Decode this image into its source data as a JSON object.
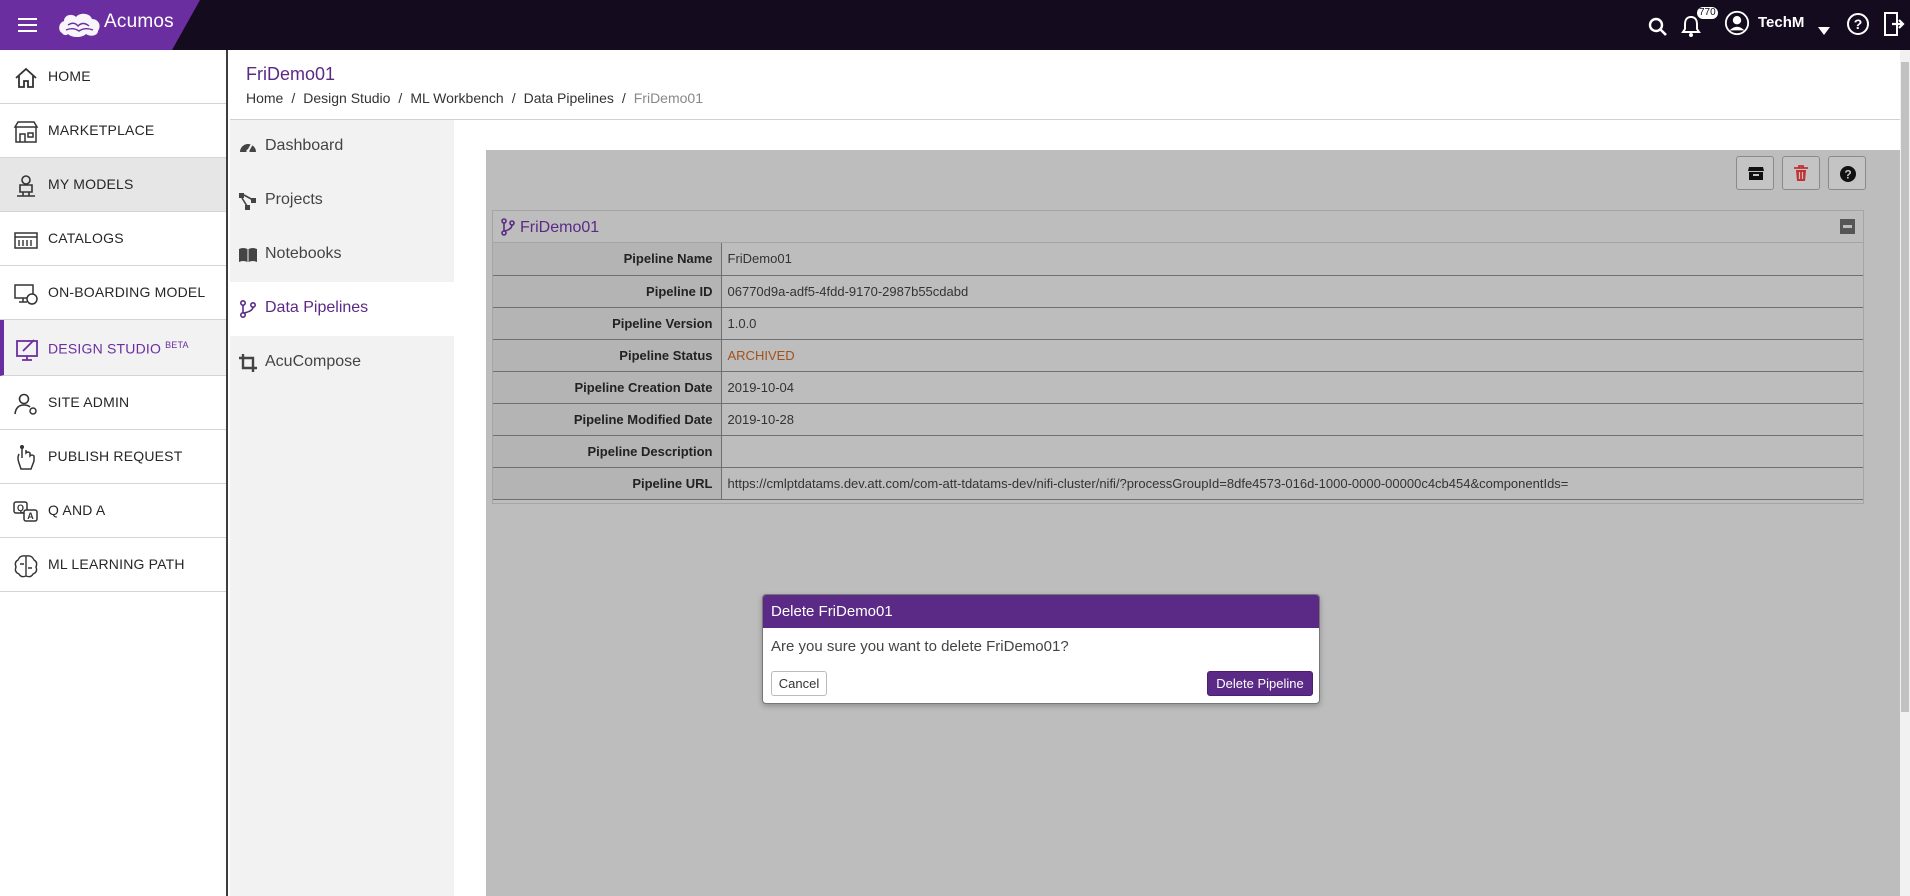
{
  "topbar": {
    "app_name": "Acumos",
    "notification_count": "770",
    "user_name": "TechM"
  },
  "sidebar": {
    "items": [
      {
        "label": "HOME",
        "icon": "home-icon"
      },
      {
        "label": "MARKETPLACE",
        "icon": "store-icon"
      },
      {
        "label": "MY MODELS",
        "icon": "robot-icon"
      },
      {
        "label": "CATALOGS",
        "icon": "catalog-icon"
      },
      {
        "label": "ON-BOARDING MODEL",
        "icon": "onboarding-icon"
      },
      {
        "label": "DESIGN STUDIO",
        "icon": "design-studio-icon",
        "badge": "BETA"
      },
      {
        "label": "SITE ADMIN",
        "icon": "admin-icon"
      },
      {
        "label": "PUBLISH REQUEST",
        "icon": "publish-icon"
      },
      {
        "label": "Q AND A",
        "icon": "qa-icon"
      },
      {
        "label": "ML LEARNING PATH",
        "icon": "brain-icon"
      }
    ]
  },
  "header": {
    "title": "FriDemo01",
    "breadcrumb": [
      "Home",
      "Design Studio",
      "ML Workbench",
      "Data Pipelines",
      "FriDemo01"
    ]
  },
  "subnav": {
    "items": [
      {
        "label": "Dashboard",
        "icon": "dashboard-icon"
      },
      {
        "label": "Projects",
        "icon": "projects-icon"
      },
      {
        "label": "Notebooks",
        "icon": "notebook-icon"
      },
      {
        "label": "Data Pipelines",
        "icon": "pipeline-icon"
      },
      {
        "label": "AcuCompose",
        "icon": "crop-icon"
      }
    ]
  },
  "panel": {
    "title": "FriDemo01",
    "rows": [
      {
        "key": "Pipeline Name",
        "value": "FriDemo01"
      },
      {
        "key": "Pipeline ID",
        "value": "06770d9a-adf5-4fdd-9170-2987b55cdabd"
      },
      {
        "key": "Pipeline Version",
        "value": "1.0.0"
      },
      {
        "key": "Pipeline Status",
        "value": "ARCHIVED"
      },
      {
        "key": "Pipeline Creation Date",
        "value": "2019-10-04"
      },
      {
        "key": "Pipeline Modified Date",
        "value": "2019-10-28"
      },
      {
        "key": "Pipeline Description",
        "value": ""
      },
      {
        "key": "Pipeline URL",
        "value": "https://cmlptdatams.dev.att.com/com-att-tdatams-dev/nifi-cluster/nifi/?processGroupId=8dfe4573-016d-1000-0000-00000c4cb454&componentIds="
      }
    ]
  },
  "modal": {
    "title": "Delete FriDemo01",
    "message": "Are you sure you want to delete FriDemo01?",
    "cancel_label": "Cancel",
    "confirm_label": "Delete Pipeline"
  },
  "colors": {
    "brand": "#6b2ea0",
    "topbar": "#140c1e",
    "accent_text": "#5b2a86",
    "status_archived": "#a0521a"
  }
}
